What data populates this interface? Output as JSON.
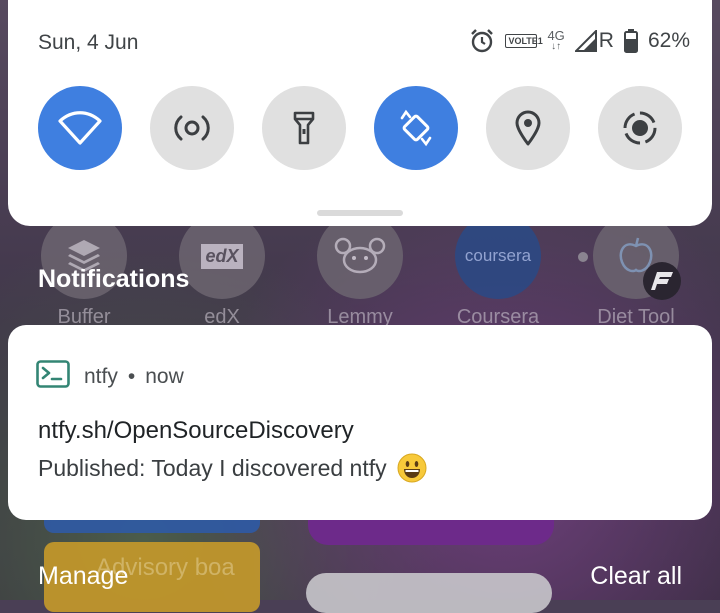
{
  "status_bar": {
    "date": "Sun, 4 Jun",
    "volte_line1": "VOLTE",
    "volte_line2": "1",
    "network_type_top": "4G",
    "network_type_arrows": "↓↑",
    "roaming": "R",
    "battery": "62%"
  },
  "quick_settings": {
    "tiles": [
      {
        "name": "wifi",
        "icon": "wifi-icon",
        "on": true
      },
      {
        "name": "hotspot",
        "icon": "hotspot-icon",
        "on": false
      },
      {
        "name": "flashlight",
        "icon": "flashlight-icon",
        "on": false
      },
      {
        "name": "auto-rotate",
        "icon": "rotate-icon",
        "on": true
      },
      {
        "name": "location",
        "icon": "location-icon",
        "on": false
      },
      {
        "name": "screen-record",
        "icon": "record-icon",
        "on": false
      }
    ],
    "accent_color": "#3f7fe0"
  },
  "background_apps": {
    "labels": [
      "Buffer",
      "edX",
      "Lemmy",
      "Coursera",
      "Diet Tool"
    ],
    "edx_logo": "edX",
    "coursera_logo": "coursera",
    "advisory_text": "Advisory boa"
  },
  "notifications": {
    "header": "Notifications",
    "items": [
      {
        "app": "ntfy",
        "separator": "•",
        "time": "now",
        "title": "ntfy.sh/OpenSourceDiscovery",
        "body": "Published: Today I discovered ntfy",
        "icon": "terminal-icon",
        "app_color": "#338574"
      }
    ]
  },
  "footer": {
    "manage": "Manage",
    "clear_all": "Clear all"
  }
}
